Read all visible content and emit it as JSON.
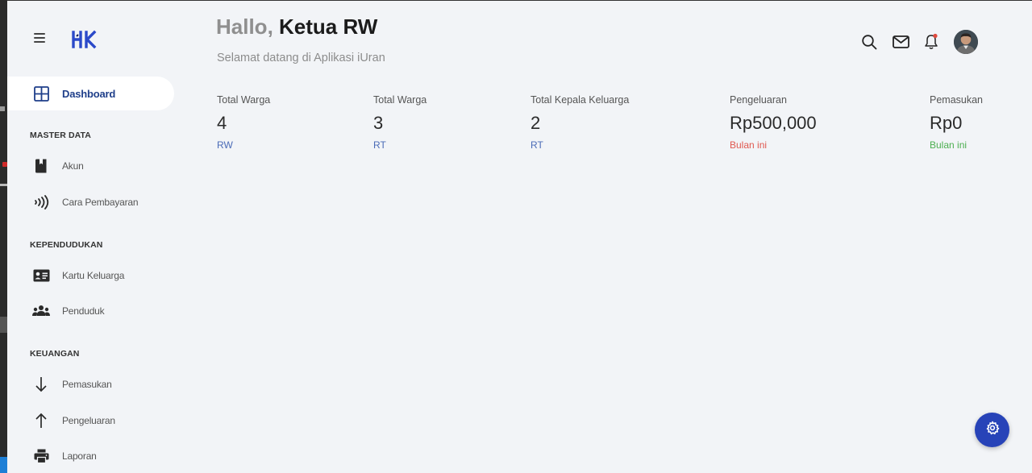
{
  "app": {
    "logo_text": "HK"
  },
  "sidebar": {
    "dashboard_label": "Dashboard",
    "sections": [
      {
        "title": "MASTER DATA",
        "items": [
          {
            "label": "Akun",
            "icon": "book-icon"
          },
          {
            "label": "Cara Pembayaran",
            "icon": "contactless-icon"
          }
        ]
      },
      {
        "title": "KEPENDUDUKAN",
        "items": [
          {
            "label": "Kartu Keluarga",
            "icon": "id-card-icon"
          },
          {
            "label": "Penduduk",
            "icon": "people-icon"
          }
        ]
      },
      {
        "title": "KEUANGAN",
        "items": [
          {
            "label": "Pemasukan",
            "icon": "arrow-down-icon"
          },
          {
            "label": "Pengeluaran",
            "icon": "arrow-up-icon"
          },
          {
            "label": "Laporan",
            "icon": "printer-icon"
          }
        ]
      }
    ]
  },
  "header": {
    "greeting_prefix": "Hallo, ",
    "greeting_name": "Ketua RW",
    "subtitle": "Selamat datang di Aplikasi iUran",
    "icons": [
      "search-icon",
      "mail-icon",
      "bell-icon",
      "avatar"
    ]
  },
  "stats": [
    {
      "label": "Total Warga",
      "value": "4",
      "sub": "RW"
    },
    {
      "label": "Total Warga",
      "value": "3",
      "sub": "RT"
    },
    {
      "label": "Total Kepala Keluarga",
      "value": "2",
      "sub": "RT"
    },
    {
      "label": "Pengeluaran",
      "value": "Rp500,000",
      "sub": "Bulan ini"
    },
    {
      "label": "Pemasukan",
      "value": "Rp0",
      "sub": "Bulan ini"
    }
  ],
  "colors": {
    "accent": "#2743b8",
    "nav_active_text": "#1f3f8a",
    "sub_blue": "#4b6bb7",
    "sub_red": "#e0584f",
    "sub_green": "#4caf50",
    "background": "#f2f4f7"
  }
}
